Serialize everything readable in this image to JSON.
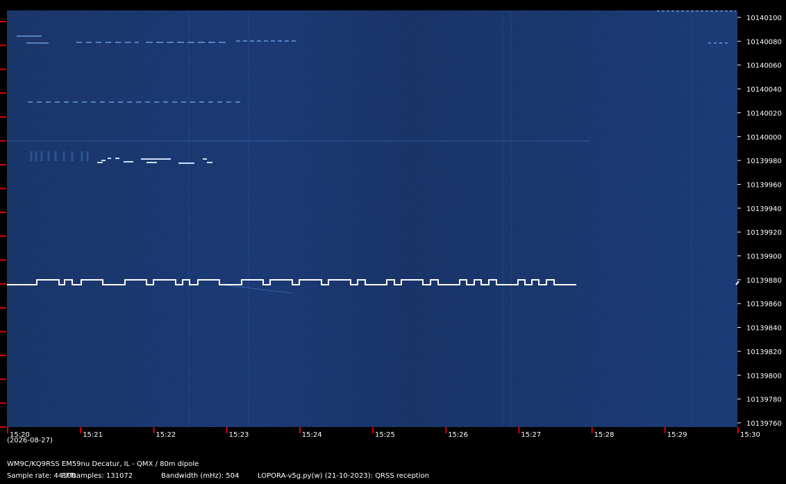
{
  "chart_data": {
    "type": "spectrogram",
    "x_axis": {
      "ticks": [
        "15:20",
        "15:21",
        "15:22",
        "15:23",
        "15:24",
        "15:25",
        "15:26",
        "15:27",
        "15:28",
        "15:29",
        "15:30"
      ],
      "date_label": "(2026-08-27)"
    },
    "y_axis": {
      "ylim": [
        10139750,
        10140110
      ],
      "ticks": [
        10140100,
        10140080,
        10140060,
        10140040,
        10140020,
        10140000,
        10139980,
        10139960,
        10139940,
        10139920,
        10139900,
        10139880,
        10139860,
        10139840,
        10139820,
        10139800,
        10139780,
        10139760
      ]
    },
    "signals": [
      {
        "name": "main-qrss-fsk-signal",
        "base_frequency": 10139876,
        "shift_up_frequency": 10139880,
        "shift_down_frequency": 10139874,
        "time_span": [
          "15:20",
          "15:27:45"
        ]
      }
    ],
    "colors": {
      "background": "#0c2358",
      "signal": "#ffffff",
      "tick_marks": "#e00000"
    },
    "grid": false
  },
  "station": "WM9C/KQ9RSS EM59nu Decatur, IL - QMX / 80m dipole",
  "sample_rate_text": "Sample rate: 44100",
  "fft_text": "FFTsamples: 131072",
  "bandwidth_text": "Bandwidth (mHz): 504",
  "software_text": "LOPORA-v5g.py(w) (21-10-2023): QRSS reception"
}
